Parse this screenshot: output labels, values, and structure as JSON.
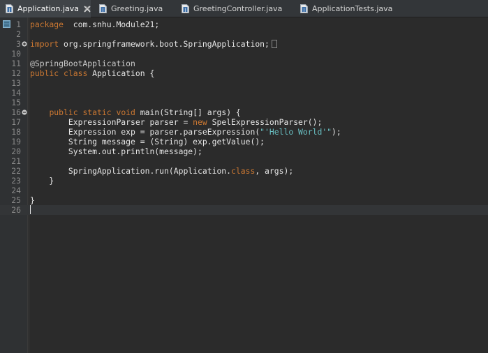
{
  "tabs": [
    {
      "label": "Application.java",
      "active": true,
      "closable": true
    },
    {
      "label": "Greeting.java",
      "active": false,
      "closable": false
    },
    {
      "label": "GreetingController.java",
      "active": false,
      "closable": false
    },
    {
      "label": "ApplicationTests.java",
      "active": false,
      "closable": false
    }
  ],
  "editor": {
    "current_line": 26,
    "lines": [
      {
        "n": "1",
        "tokens": [
          [
            "kw",
            "package"
          ],
          [
            "",
            "  com.snhu.Module21;"
          ]
        ]
      },
      {
        "n": "2",
        "tokens": []
      },
      {
        "n": "3",
        "fold": "expand",
        "tokens": [
          [
            "kw",
            "import"
          ],
          [
            "",
            " org.springframework.boot.SpringApplication;"
          ]
        ],
        "collapsed": true
      },
      {
        "n": "10",
        "tokens": []
      },
      {
        "n": "11",
        "tokens": [
          [
            "ann",
            "@SpringBootApplication"
          ]
        ]
      },
      {
        "n": "12",
        "tokens": [
          [
            "kw",
            "public"
          ],
          [
            "",
            " "
          ],
          [
            "kw",
            "class"
          ],
          [
            "",
            " Application {"
          ]
        ]
      },
      {
        "n": "13",
        "tokens": []
      },
      {
        "n": "14",
        "tokens": []
      },
      {
        "n": "15",
        "tokens": []
      },
      {
        "n": "16",
        "fold": "collapse",
        "tokens": [
          [
            "",
            "    "
          ],
          [
            "kw",
            "public"
          ],
          [
            "",
            " "
          ],
          [
            "kw",
            "static"
          ],
          [
            "",
            " "
          ],
          [
            "kw",
            "void"
          ],
          [
            "",
            " main(String[] args) {"
          ]
        ]
      },
      {
        "n": "17",
        "tokens": [
          [
            "",
            "        ExpressionParser parser = "
          ],
          [
            "kw",
            "new"
          ],
          [
            "",
            " SpelExpressionParser();"
          ]
        ]
      },
      {
        "n": "18",
        "tokens": [
          [
            "",
            "        Expression exp = parser.parseExpression("
          ],
          [
            "str",
            "\"'Hello World'\""
          ],
          [
            "",
            ");"
          ]
        ]
      },
      {
        "n": "19",
        "tokens": [
          [
            "",
            "        String message = (String) exp.getValue();"
          ]
        ]
      },
      {
        "n": "20",
        "tokens": [
          [
            "",
            "        System.out.println(message);"
          ]
        ]
      },
      {
        "n": "21",
        "tokens": []
      },
      {
        "n": "22",
        "tokens": [
          [
            "",
            "        SpringApplication.run(Application."
          ],
          [
            "kw",
            "class"
          ],
          [
            "",
            ", args);"
          ]
        ]
      },
      {
        "n": "23",
        "tokens": [
          [
            "",
            "    }"
          ]
        ]
      },
      {
        "n": "24",
        "tokens": []
      },
      {
        "n": "25",
        "tokens": [
          [
            "",
            "}"
          ]
        ]
      },
      {
        "n": "26",
        "tokens": [],
        "caret": true
      }
    ]
  },
  "colors": {
    "background": "#2b2b2b",
    "keyword": "#cc7832",
    "string": "#6ac1c4",
    "text": "#e6e6e6",
    "line_number": "#8a8a8a"
  }
}
